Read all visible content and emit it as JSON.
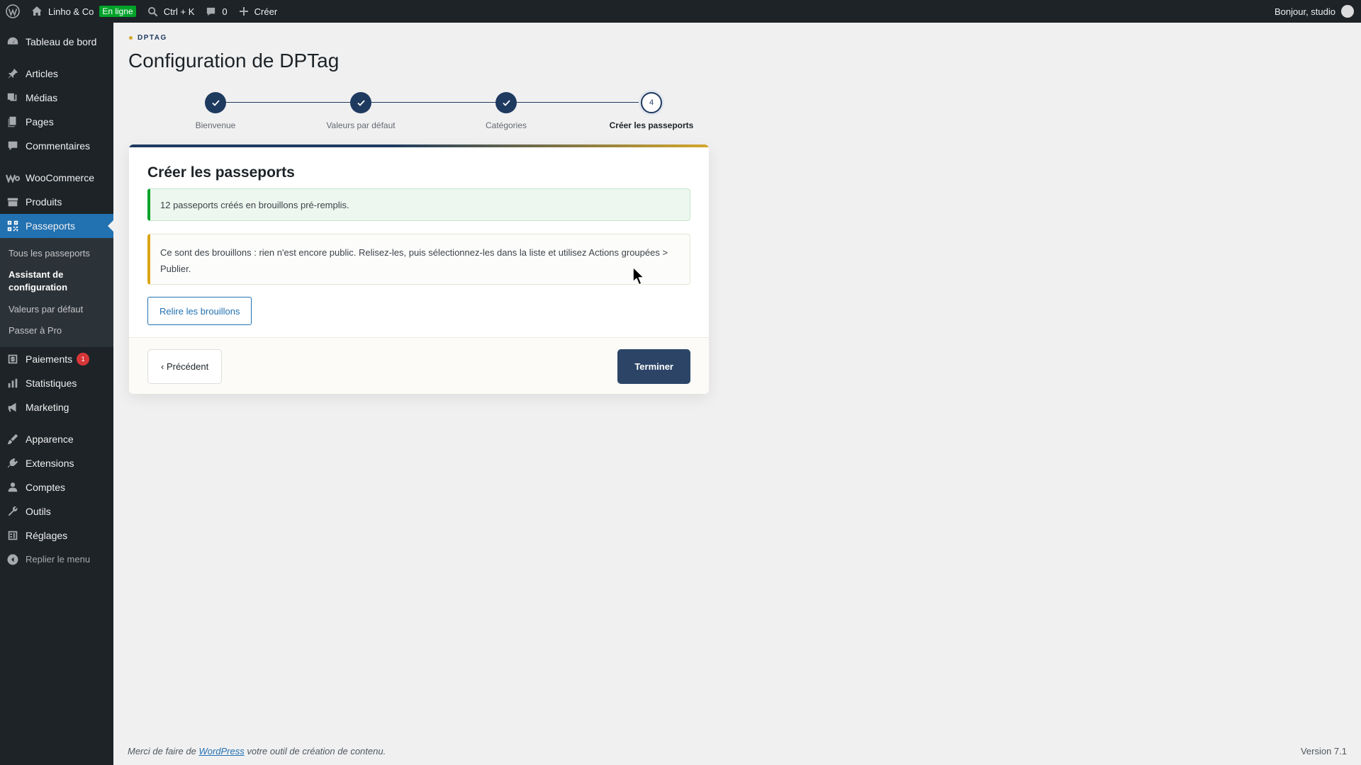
{
  "adminbar": {
    "site_name": "Linho & Co",
    "status_badge": "En ligne",
    "search_shortcut": "Ctrl + K",
    "comments_count": "0",
    "create_label": "Créer",
    "greeting": "Bonjour, studio"
  },
  "sidebar": {
    "items": [
      {
        "label": "Tableau de bord",
        "icon": "dashboard-icon"
      },
      {
        "label": "Articles",
        "icon": "pin-icon"
      },
      {
        "label": "Médias",
        "icon": "media-icon"
      },
      {
        "label": "Pages",
        "icon": "pages-icon"
      },
      {
        "label": "Commentaires",
        "icon": "comment-icon"
      },
      {
        "label": "WooCommerce",
        "icon": "woo-icon"
      },
      {
        "label": "Produits",
        "icon": "archive-icon"
      },
      {
        "label": "Passeports",
        "icon": "qr-icon"
      },
      {
        "label": "Paiements",
        "icon": "payment-icon",
        "badge": "1"
      },
      {
        "label": "Statistiques",
        "icon": "chart-icon"
      },
      {
        "label": "Marketing",
        "icon": "megaphone-icon"
      },
      {
        "label": "Apparence",
        "icon": "brush-icon"
      },
      {
        "label": "Extensions",
        "icon": "plugin-icon"
      },
      {
        "label": "Comptes",
        "icon": "user-icon"
      },
      {
        "label": "Outils",
        "icon": "wrench-icon"
      },
      {
        "label": "Réglages",
        "icon": "settings-icon"
      }
    ],
    "submenu": [
      "Tous les passeports",
      "Assistant de configuration",
      "Valeurs par défaut",
      "Passer à Pro"
    ],
    "collapse_label": "Replier le menu"
  },
  "page": {
    "eyebrow": "DPTAG",
    "title": "Configuration de DPTag"
  },
  "stepper": {
    "steps": [
      {
        "label": "Bienvenue",
        "state": "done"
      },
      {
        "label": "Valeurs par défaut",
        "state": "done"
      },
      {
        "label": "Catégories",
        "state": "done"
      },
      {
        "label": "Créer les passeports",
        "state": "active",
        "number": "4"
      }
    ]
  },
  "card": {
    "title": "Créer les passeports",
    "success_notice": "12 passeports créés en brouillons pré-remplis.",
    "warning_notice": "Ce sont des brouillons : rien n'est encore public. Relisez-les, puis sélectionnez-les dans la liste et utilisez Actions groupées > Publier.",
    "review_button": "Relire les brouillons",
    "prev_button": "‹ Précédent",
    "finish_button": "Terminer"
  },
  "footer": {
    "thanks_prefix": "Merci de faire de ",
    "thanks_link": "WordPress",
    "thanks_suffix": " votre outil de création de contenu.",
    "version": "Version 7.1"
  },
  "colors": {
    "accent": "#1e3a5f",
    "gold": "#d4a72c",
    "wp_blue": "#2271b1",
    "success": "#00a32a",
    "warning": "#dba617"
  }
}
